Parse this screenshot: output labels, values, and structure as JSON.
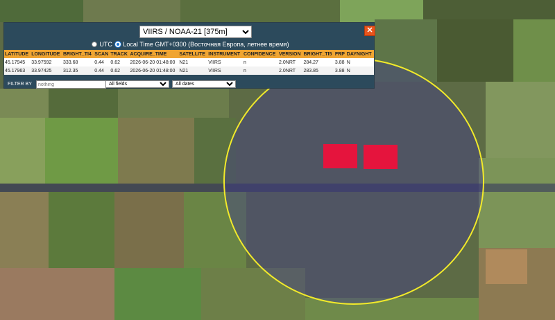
{
  "header": {
    "satellite_selected": "VIIRS / NOAA-21 [375m]",
    "close_label": "✕"
  },
  "timezone": {
    "utc_label": "UTC",
    "local_label": "Local Time GMT+0300 (Восточная Европа, летнее время)",
    "selected": "local"
  },
  "table": {
    "columns": [
      "LATITUDE",
      "LONGITUDE",
      "BRIGHT_TI4",
      "SCAN",
      "TRACK",
      "ACQUIRE_TIME",
      "SATELLITE",
      "INSTRUMENT",
      "CONFIDENCE",
      "VERSION",
      "BRIGHT_TI5",
      "FRP",
      "DAYNIGHT"
    ],
    "rows": [
      [
        "45.17945",
        "33.97592",
        "333.68",
        "0.44",
        "0.62",
        "2026-06-20 01:48:00",
        "N21",
        "VIIRS",
        "n",
        "2.0NRT",
        "284.27",
        "3.88",
        "N"
      ],
      [
        "45.17963",
        "33.97425",
        "312.35",
        "0.44",
        "0.62",
        "2026-06-20 01:48:00",
        "N21",
        "VIIRS",
        "n",
        "2.0NRT",
        "283.85",
        "3.88",
        "N"
      ]
    ]
  },
  "filter": {
    "label": "FILTER BY",
    "input_placeholder": "nothing",
    "fields_selected": "All fields",
    "dates_selected": "All dates"
  },
  "colors": {
    "panel_bg": "#2c4a5c",
    "header_bg": "#f0a532",
    "hotspot": "#e5143d",
    "radius_circle": "#f2ea2a"
  }
}
